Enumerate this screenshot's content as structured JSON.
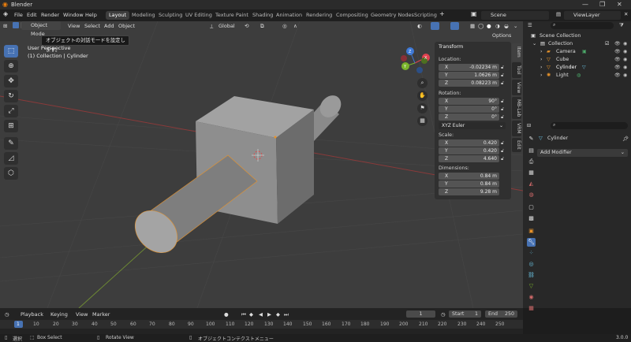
{
  "window": {
    "title": "Blender",
    "controls": [
      "—",
      "❐",
      "✕"
    ]
  },
  "menu": [
    "File",
    "Edit",
    "Render",
    "Window",
    "Help"
  ],
  "workspaces": [
    "Layout",
    "Modeling",
    "Sculpting",
    "UV Editing",
    "Texture Paint",
    "Shading",
    "Animation",
    "Rendering",
    "Compositing",
    "Geometry Nodes",
    "Scripting"
  ],
  "scene": {
    "name": "Scene",
    "view_layer": "ViewLayer"
  },
  "viewport_header": {
    "mode": "Object Mode",
    "menus": [
      "View",
      "Select",
      "Add",
      "Object"
    ],
    "transform_orientation": "Global",
    "options": "Options"
  },
  "tooltip": "オブジェクトの対話モードを設定します。",
  "viewport_overlay": {
    "view": "User Perspective",
    "collection": "(1) Collection | Cylinder"
  },
  "gizmo_axes": {
    "x": "X",
    "y": "Y",
    "z": "Z"
  },
  "npanel": {
    "title": "Transform",
    "location_label": "Location:",
    "location": [
      {
        "axis": "X",
        "value": "-0.02234 m"
      },
      {
        "axis": "Y",
        "value": "1.0626 m"
      },
      {
        "axis": "Z",
        "value": "0.08223 m"
      }
    ],
    "rotation_label": "Rotation:",
    "rotation": [
      {
        "axis": "X",
        "value": "90°"
      },
      {
        "axis": "Y",
        "value": "0°"
      },
      {
        "axis": "Z",
        "value": "0°"
      }
    ],
    "rotation_mode": "XYZ Euler",
    "scale_label": "Scale:",
    "scale": [
      {
        "axis": "X",
        "value": "0.420"
      },
      {
        "axis": "Y",
        "value": "0.420"
      },
      {
        "axis": "Z",
        "value": "4.640"
      }
    ],
    "dimensions_label": "Dimensions:",
    "dimensions": [
      {
        "axis": "X",
        "value": "0.84 m"
      },
      {
        "axis": "Y",
        "value": "0.84 m"
      },
      {
        "axis": "Z",
        "value": "9.28 m"
      }
    ],
    "tabs": [
      "Item",
      "Tool",
      "View",
      "MB-Lab",
      "VRM",
      "Edit"
    ]
  },
  "outliner": {
    "root": "Scene Collection",
    "collection": "Collection",
    "objects": [
      "Camera",
      "Cube",
      "Cylinder",
      "Light"
    ]
  },
  "properties": {
    "object": "Cylinder",
    "add_modifier": "Add Modifier"
  },
  "timeline": {
    "menus": [
      "Playback",
      "Keying",
      "View",
      "Marker"
    ],
    "current_frame": "1",
    "start_label": "Start",
    "start": "1",
    "end_label": "End",
    "end": "250",
    "ticks": [
      "1",
      "10",
      "20",
      "30",
      "40",
      "50",
      "60",
      "70",
      "80",
      "90",
      "100",
      "110",
      "120",
      "130",
      "140",
      "150",
      "160",
      "170",
      "180",
      "190",
      "200",
      "210",
      "220",
      "230",
      "240",
      "250"
    ]
  },
  "status": {
    "select": "選択",
    "box_select": "Box Select",
    "rotate_view": "Rotate View",
    "context_menu": "オブジェクトコンテクストメニュー",
    "version": "3.0.0"
  },
  "colors": {
    "accent": "#4772b3",
    "viewport_bg": "#3d3d3d",
    "panel": "#303030",
    "x_axis": "#e0424f",
    "y_axis": "#7bb42b",
    "z_axis": "#3e79d6"
  }
}
